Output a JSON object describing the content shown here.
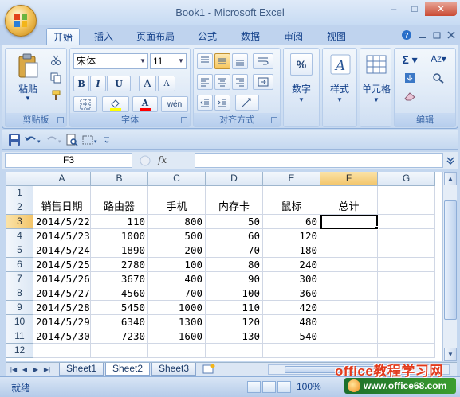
{
  "window": {
    "title": "Book1 - Microsoft Excel",
    "controls": [
      "–",
      "□",
      "✕"
    ]
  },
  "tabs": [
    {
      "label": "开始",
      "active": true
    },
    {
      "label": "插入"
    },
    {
      "label": "页面布局"
    },
    {
      "label": "公式"
    },
    {
      "label": "数据"
    },
    {
      "label": "审阅"
    },
    {
      "label": "视图"
    }
  ],
  "ribbon": {
    "clipboard": {
      "label": "剪贴板",
      "paste": "粘贴"
    },
    "font": {
      "label": "字体",
      "name": "宋体",
      "size": "11",
      "bold": "B",
      "italic": "I",
      "underline": "U",
      "grow": "A",
      "shrink": "A",
      "phonetic": "wén",
      "font_color": "A"
    },
    "alignment": {
      "label": "对齐方式"
    },
    "number": {
      "label": "数字",
      "symbol": "%"
    },
    "styles": {
      "label": "样式"
    },
    "cells": {
      "label": "单元格"
    },
    "editing": {
      "label": "编辑"
    }
  },
  "formula_bar": {
    "name_box": "F3",
    "fx": "fx",
    "formula": ""
  },
  "sheet": {
    "columns": [
      "A",
      "B",
      "C",
      "D",
      "E",
      "F",
      "G"
    ],
    "selected_column": "F",
    "selected_row": 3,
    "active_cell": "F3",
    "rows": [
      {
        "n": "1",
        "cells": [
          "",
          "",
          "",
          "",
          "",
          "",
          ""
        ]
      },
      {
        "n": "2",
        "cells": [
          "销售日期",
          "路由器",
          "手机",
          "内存卡",
          "鼠标",
          "总计",
          ""
        ]
      },
      {
        "n": "3",
        "cells": [
          "2014/5/22",
          "110",
          "800",
          "50",
          "60",
          "",
          ""
        ]
      },
      {
        "n": "4",
        "cells": [
          "2014/5/23",
          "1000",
          "500",
          "60",
          "120",
          "",
          ""
        ]
      },
      {
        "n": "5",
        "cells": [
          "2014/5/24",
          "1890",
          "200",
          "70",
          "180",
          "",
          ""
        ]
      },
      {
        "n": "6",
        "cells": [
          "2014/5/25",
          "2780",
          "100",
          "80",
          "240",
          "",
          ""
        ]
      },
      {
        "n": "7",
        "cells": [
          "2014/5/26",
          "3670",
          "400",
          "90",
          "300",
          "",
          ""
        ]
      },
      {
        "n": "8",
        "cells": [
          "2014/5/27",
          "4560",
          "700",
          "100",
          "360",
          "",
          ""
        ]
      },
      {
        "n": "9",
        "cells": [
          "2014/5/28",
          "5450",
          "1000",
          "110",
          "420",
          "",
          ""
        ]
      },
      {
        "n": "10",
        "cells": [
          "2014/5/29",
          "6340",
          "1300",
          "120",
          "480",
          "",
          ""
        ]
      },
      {
        "n": "11",
        "cells": [
          "2014/5/30",
          "7230",
          "1600",
          "130",
          "540",
          "",
          ""
        ]
      },
      {
        "n": "12",
        "cells": [
          "",
          "",
          "",
          "",
          "",
          "",
          ""
        ]
      }
    ]
  },
  "sheet_tabs": [
    {
      "label": "Sheet1"
    },
    {
      "label": "Sheet2",
      "active": true
    },
    {
      "label": "Sheet3"
    }
  ],
  "status": {
    "text": "就绪",
    "zoom": "100%"
  },
  "watermark": {
    "line1": "office教程学习网",
    "line2": "www.office68.com"
  }
}
